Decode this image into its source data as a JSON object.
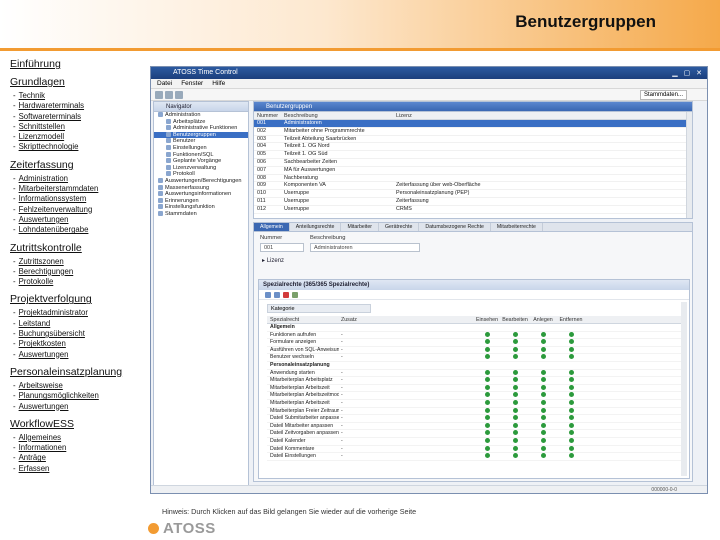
{
  "header": {
    "title": "Benutzergruppen"
  },
  "nav": [
    {
      "title": "Einführung",
      "items": []
    },
    {
      "title": "Grundlagen",
      "items": [
        "Technik",
        "Hardwareterminals",
        "Softwareterminals",
        "Schnittstellen",
        "Lizenzmodell",
        "Skripttechnologie"
      ]
    },
    {
      "title": "Zeiterfassung",
      "items": [
        "Administration",
        "Mitarbeiterstammdaten",
        "Informationssystem",
        "Fehlzeitenverwaltung",
        "Auswertungen",
        "Lohndatenübergabe"
      ]
    },
    {
      "title": "Zutrittskontrolle",
      "items": [
        "Zutrittszonen",
        "Berechtigungen",
        "Protokolle"
      ]
    },
    {
      "title": "Projektverfolgung",
      "items": [
        "Projektadministrator",
        "Leitstand",
        "Buchungsübersicht",
        "Projektkosten",
        "Auswertungen"
      ]
    },
    {
      "title": "Personaleinsatzplanung",
      "items": [
        "Arbeitsweise",
        "Planungsmöglichkeiten",
        "Auswertungen"
      ]
    },
    {
      "title": "WorkflowESS",
      "items": [
        "Allgemeines",
        "Informationen",
        "Anträge",
        "Erfassen"
      ]
    }
  ],
  "app": {
    "title": "ATOSS Time Control",
    "menu": [
      "Datei",
      "Fenster",
      "Hilfe"
    ],
    "perspective": "Stammdaten...",
    "tree_tab": "Navigator",
    "tree": [
      {
        "label": "Administration",
        "depth": 0,
        "selected": false
      },
      {
        "label": "Arbeitsplätze",
        "depth": 1,
        "selected": false
      },
      {
        "label": "Administrative Funktionen",
        "depth": 1,
        "selected": false
      },
      {
        "label": "Benutzergruppen",
        "depth": 1,
        "selected": true
      },
      {
        "label": "Benutzer",
        "depth": 1,
        "selected": false
      },
      {
        "label": "Einstellungen",
        "depth": 1,
        "selected": false
      },
      {
        "label": "Funktionen/SQL",
        "depth": 1,
        "selected": false
      },
      {
        "label": "Geplante Vorgänge",
        "depth": 1,
        "selected": false
      },
      {
        "label": "Lizenzverwaltung",
        "depth": 1,
        "selected": false
      },
      {
        "label": "Protokoll",
        "depth": 1,
        "selected": false
      },
      {
        "label": "Auswertungen/Berechtigungen",
        "depth": 0,
        "selected": false
      },
      {
        "label": "Massenerfassung",
        "depth": 0,
        "selected": false
      },
      {
        "label": "Auswertungsinformationen",
        "depth": 0,
        "selected": false
      },
      {
        "label": "Erinnerungen",
        "depth": 0,
        "selected": false
      },
      {
        "label": "Einstellungsfunktion",
        "depth": 0,
        "selected": false
      },
      {
        "label": "Stammdaten",
        "depth": 0,
        "selected": false
      }
    ],
    "list_tab": "Benutzergruppen",
    "list_columns": [
      "Nummer",
      "Beschreibung",
      "Lizenz"
    ],
    "list_rows": [
      [
        "001",
        "Administratoren",
        ""
      ],
      [
        "002",
        "Mitarbeiter ohne Programmrechte",
        ""
      ],
      [
        "003",
        "Teilzeit Abteilung Saarbrücken",
        ""
      ],
      [
        "004",
        "Teilzeit 1. OG Nord",
        ""
      ],
      [
        "005",
        "Teilzeit 1. OG Süd",
        ""
      ],
      [
        "006",
        "Sachbearbeiter Zeiten",
        ""
      ],
      [
        "007",
        "MA für Auswertungen",
        ""
      ],
      [
        "008",
        "Nachberatung",
        ""
      ],
      [
        "009",
        "Komponenten VA",
        "Zeiterfassung über web-Oberfläche"
      ],
      [
        "010",
        "Userruppe",
        "Personaleinsatzplanung (PEP)"
      ],
      [
        "011",
        "Userruppe",
        "Zeiterfassung"
      ],
      [
        "012",
        "Userruppe",
        "CRMS"
      ]
    ],
    "detail_tabs": [
      "Allgemein",
      "Anteilungsrechte",
      "Mitarbeiter",
      "Gerätrechte",
      "Datumsbezogene Rechte",
      "Mitarbeiterrechte"
    ],
    "detail": {
      "nummer_label": "Nummer",
      "beschreibung_label": "Beschreibung",
      "nummer_value": "001",
      "beschreibung_value": "Administratoren",
      "lizenz_section": "Lizenz",
      "rights_title": "Spezialrechte (365/365 Spezialrechte)",
      "kategorie": "Kategorie"
    },
    "rights_columns": [
      "Spezialrecht",
      "Zusatz",
      "Einsehen",
      "Bearbeiten",
      "Anlegen",
      "Entfernen"
    ],
    "rights_rows": [
      {
        "name": "Allgemein",
        "zusatz": "",
        "group": true,
        "flags": [
          false,
          false,
          false,
          false
        ]
      },
      {
        "name": "Funktionen aufrufen",
        "zusatz": "-",
        "group": false,
        "flags": [
          true,
          true,
          true,
          true
        ]
      },
      {
        "name": "Formulare anzeigen",
        "zusatz": "-",
        "group": false,
        "flags": [
          true,
          true,
          true,
          true
        ]
      },
      {
        "name": "Ausführen von SQL-Anweisungen",
        "zusatz": "-",
        "group": false,
        "flags": [
          true,
          true,
          true,
          true
        ]
      },
      {
        "name": "Benutzer wechseln",
        "zusatz": "-",
        "group": false,
        "flags": [
          true,
          true,
          true,
          true
        ]
      },
      {
        "name": "Personaleinsatzplanung",
        "zusatz": "",
        "group": true,
        "flags": [
          false,
          false,
          false,
          false
        ]
      },
      {
        "name": "Anwendung starten",
        "zusatz": "-",
        "group": false,
        "flags": [
          true,
          true,
          true,
          true
        ]
      },
      {
        "name": "Mitarbeiterplan Arbeitsplatz",
        "zusatz": "-",
        "group": false,
        "flags": [
          true,
          true,
          true,
          true
        ]
      },
      {
        "name": "Mitarbeiterplan Arbeitszeit",
        "zusatz": "-",
        "group": false,
        "flags": [
          true,
          true,
          true,
          true
        ]
      },
      {
        "name": "Mitarbeiterplan Arbeitszeitmodell",
        "zusatz": "-",
        "group": false,
        "flags": [
          true,
          true,
          true,
          true
        ]
      },
      {
        "name": "Mitarbeiterplan Arbeitszeit",
        "zusatz": "-",
        "group": false,
        "flags": [
          true,
          true,
          true,
          true
        ]
      },
      {
        "name": "Mitarbeiterplan Freier Zeitraum",
        "zusatz": "-",
        "group": false,
        "flags": [
          true,
          true,
          true,
          true
        ]
      },
      {
        "name": "Dateil Submitarbeiter anpassen",
        "zusatz": "-",
        "group": false,
        "flags": [
          true,
          true,
          true,
          true
        ]
      },
      {
        "name": "Dateil Mitarbeiter anpassen",
        "zusatz": "-",
        "group": false,
        "flags": [
          true,
          true,
          true,
          true
        ]
      },
      {
        "name": "Dateil Zeitvorgaben anpassen",
        "zusatz": "-",
        "group": false,
        "flags": [
          true,
          true,
          true,
          true
        ]
      },
      {
        "name": "Dateil Kalender",
        "zusatz": "-",
        "group": false,
        "flags": [
          true,
          true,
          true,
          true
        ]
      },
      {
        "name": "Dateil Kommentare",
        "zusatz": "-",
        "group": false,
        "flags": [
          true,
          true,
          true,
          true
        ]
      },
      {
        "name": "Dateil Einstellungen",
        "zusatz": "-",
        "group": false,
        "flags": [
          true,
          true,
          true,
          true
        ]
      }
    ],
    "status": "000000-0-0"
  },
  "footer": {
    "hint": "Hinweis: Durch Klicken auf das Bild gelangen Sie wieder auf die vorherige Seite",
    "logo_text": "ATOSS"
  },
  "colors": {
    "accent": "#f29b32",
    "selection": "#3a6fc4",
    "check": "#2c9a3c"
  }
}
